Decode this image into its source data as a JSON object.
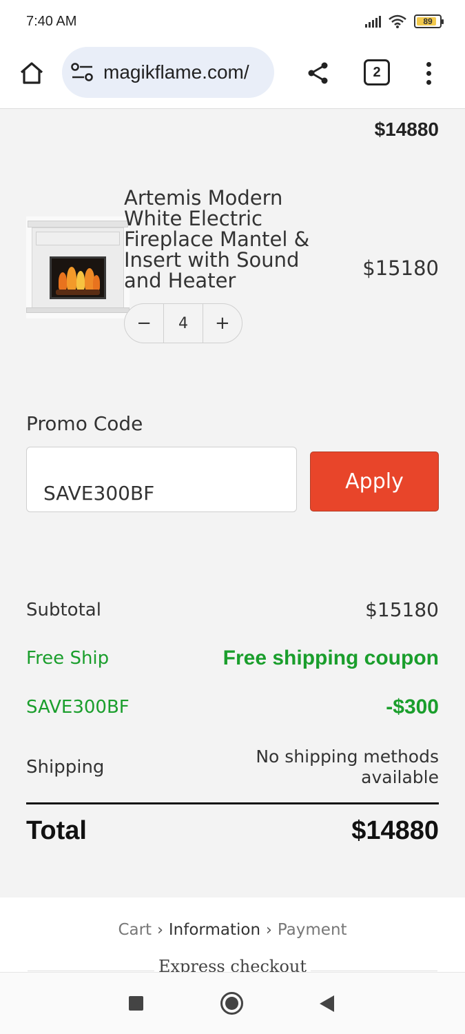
{
  "status_bar": {
    "time": "7:40 AM",
    "battery_level": "89",
    "icons": [
      "signal-icon",
      "wifi-icon",
      "battery-icon"
    ]
  },
  "browser": {
    "url": "magikflame.com/",
    "tab_count": "2",
    "icons": [
      "home-icon",
      "site-settings-icon",
      "share-icon",
      "tabs-icon",
      "more-options-icon"
    ]
  },
  "cart": {
    "header_total": "$14880",
    "item": {
      "title": "Artemis Modern White Electric Fireplace Mantel & Insert with Sound and Heater",
      "price": "$15180",
      "quantity": "4",
      "decrement_label": "−",
      "increment_label": "+"
    }
  },
  "promo": {
    "label": "Promo Code",
    "value": "SAVE300BF",
    "apply_label": "Apply"
  },
  "summary": {
    "subtotal_label": "Subtotal",
    "subtotal_value": "$15180",
    "free_ship_label": "Free Ship",
    "free_ship_value": "Free shipping coupon",
    "discount_label": "SAVE300BF",
    "discount_value": "-$300",
    "shipping_label": "Shipping",
    "shipping_value_line1": "No shipping methods",
    "shipping_value_line2": "available",
    "total_label": "Total",
    "total_value": "$14880"
  },
  "checkout_steps": {
    "cart": "Cart",
    "separator": "›",
    "information": "Information",
    "payment": "Payment"
  },
  "express_checkout": "Express checkout",
  "colors": {
    "apply_button": "#e8452a",
    "discount_green": "#1a9e2c",
    "page_background": "#f3f3f3"
  }
}
